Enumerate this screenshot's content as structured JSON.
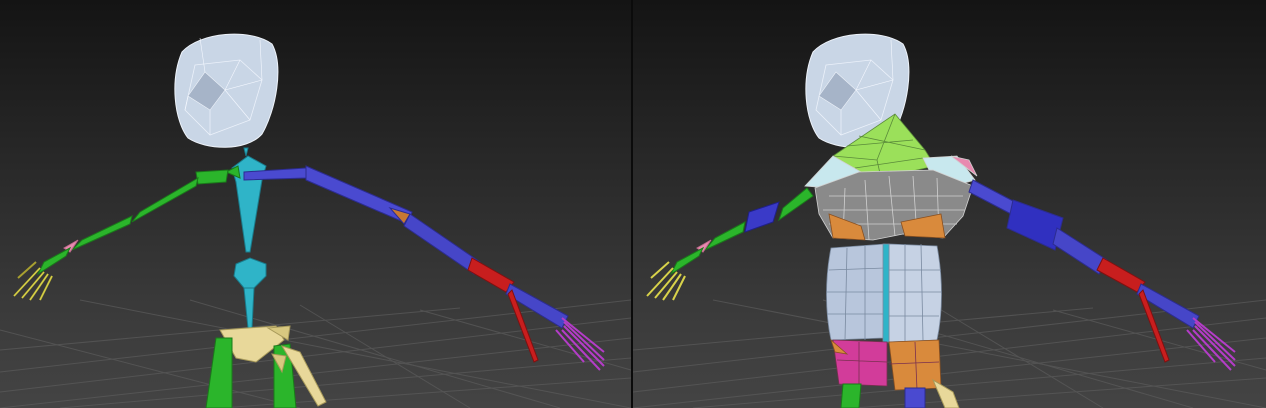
{
  "viewports": [
    {
      "id": "left",
      "content": "skeleton-rig"
    },
    {
      "id": "right",
      "content": "skinned-rig-with-mesh"
    }
  ],
  "colors": {
    "background_top": "#141414",
    "background_bottom": "#444444",
    "grid": "#5a5a5a",
    "head": "#c9d6e6",
    "spine": "#2fb4c8",
    "upper_arm": "#4a4ad0",
    "forearm_right": "#4646c8",
    "arm_left": "#2bb52b",
    "hand_left": "#d8d24a",
    "hand_right": "#b43cc8",
    "pelvis": "#e8d89a",
    "red_bone": "#c81e1e",
    "mesh_torso": "#b8c6dc",
    "mesh_collar": "#9be05a",
    "mesh_shoulder": "#8a8a8a",
    "mesh_orange": "#d98a3c",
    "mesh_pink": "#d23c9a"
  }
}
